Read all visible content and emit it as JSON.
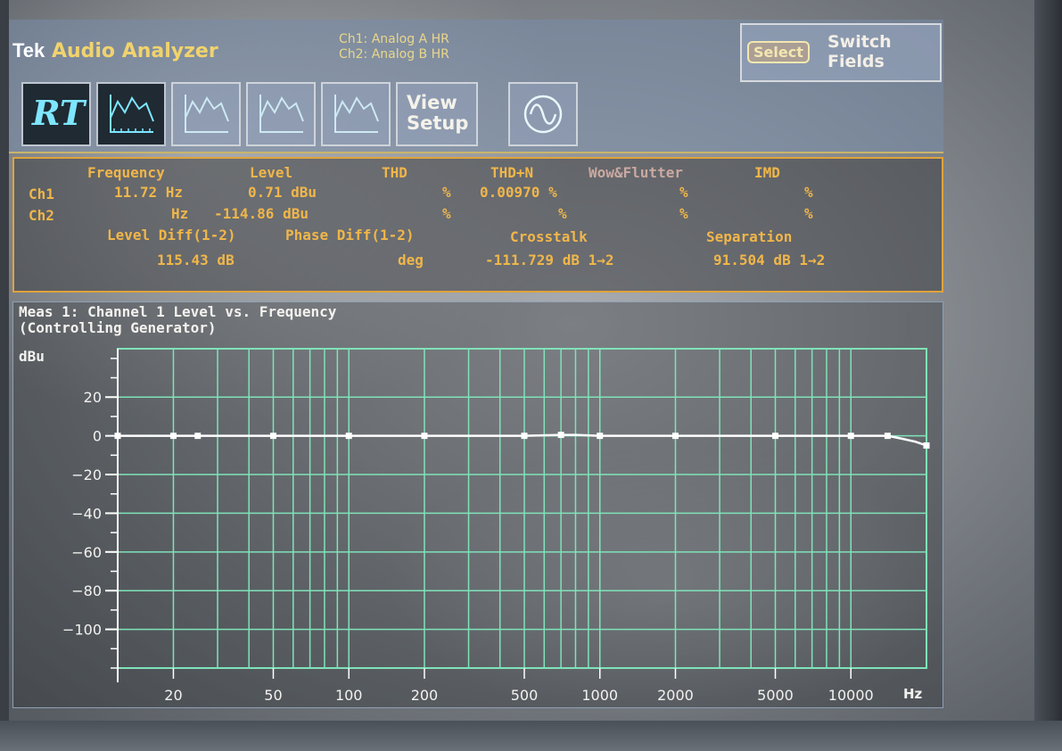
{
  "app": {
    "brand": "Tek",
    "title": "Audio Analyzer",
    "ch1_source": "Ch1: Analog A HR",
    "ch2_source": "Ch2: Analog B HR"
  },
  "switch_fields": {
    "select_label": "Select",
    "line1": "Switch",
    "line2": "Fields"
  },
  "toolbar": {
    "rt_label": "RT",
    "view_setup_line1": "View",
    "view_setup_line2": "Setup",
    "icons": [
      "realtime-icon",
      "graph-1-icon",
      "graph-2-icon",
      "graph-3-icon",
      "graph-4-icon",
      "view-setup-icon",
      "generator-sine-icon"
    ]
  },
  "readings": {
    "headers": {
      "frequency": "Frequency",
      "level": "Level",
      "thd": "THD",
      "thdn": "THD+N",
      "wow": "Wow&Flutter",
      "imd": "IMD"
    },
    "ch1": {
      "label": "Ch1",
      "frequency": "11.72 Hz",
      "level": "0.71 dBu",
      "thd": "%",
      "thdn": "0.00970 %",
      "wow": "%",
      "imd": "%"
    },
    "ch2": {
      "label": "Ch2",
      "frequency": "Hz",
      "level": "-114.86 dBu",
      "thd": "%",
      "thdn": "%",
      "wow": "%",
      "imd": "%"
    },
    "headers2": {
      "level_diff": "Level Diff(1-2)",
      "phase_diff": "Phase Diff(1-2)",
      "crosstalk": "Crosstalk",
      "separation": "Separation"
    },
    "values2": {
      "level_diff": "115.43 dB",
      "phase_diff": "deg",
      "crosstalk": "-111.729 dB 1→2",
      "separation": "91.504 dB 1→2"
    }
  },
  "chart_data": {
    "type": "line",
    "title": "Meas 1: Channel 1 Level vs. Frequency",
    "subtitle": "(Controlling Generator)",
    "ylabel": "dBu",
    "xlabel": "Hz",
    "xscale": "log",
    "xlim": [
      12,
      20000
    ],
    "ylim": [
      -120,
      45
    ],
    "x_ticks": [
      20,
      50,
      100,
      200,
      500,
      1000,
      2000,
      5000,
      10000
    ],
    "x_tick_labels": [
      "20",
      "50",
      "100",
      "200",
      "500",
      "1000",
      "2000",
      "5000",
      "10000"
    ],
    "y_ticks": [
      20,
      0,
      -20,
      -40,
      -60,
      -80,
      -100
    ],
    "y_tick_labels": [
      "20",
      "0",
      "−20",
      "−40",
      "−60",
      "−80",
      "−100"
    ],
    "grid": true,
    "series": [
      {
        "x": [
          12,
          20,
          25,
          50,
          100,
          200,
          500,
          700,
          800,
          1000,
          2000,
          5000,
          10000,
          14000,
          16000,
          18000,
          20000
        ],
        "values": [
          0,
          0,
          0,
          0,
          0,
          0,
          0,
          0.5,
          0.5,
          0,
          0,
          0,
          0,
          0,
          -1.5,
          -3,
          -5
        ]
      }
    ],
    "markers": {
      "x": [
        12,
        20,
        25,
        50,
        100,
        200,
        500,
        700,
        1000,
        2000,
        5000,
        10000,
        14000,
        20000
      ],
      "values": [
        0,
        0,
        0,
        0,
        0,
        0,
        0,
        0.5,
        0,
        0,
        0,
        0,
        0,
        -5
      ]
    },
    "colors": {
      "grid": "#7fe3b9",
      "trace": "#ffffff",
      "axis": "#ffffff"
    }
  }
}
